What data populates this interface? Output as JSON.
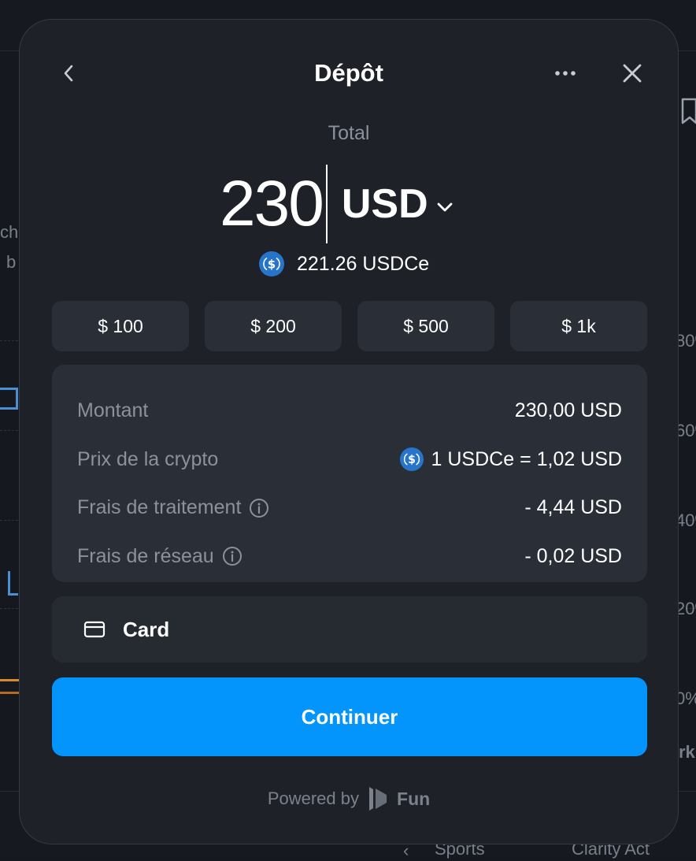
{
  "background": {
    "fragments": [
      "ch",
      "b",
      "80%",
      "60%",
      "40%",
      "20%",
      "0%",
      "rk",
      "Sports",
      "Clarity Act"
    ]
  },
  "modal": {
    "title": "Dépôt",
    "total_label": "Total",
    "amount_value": "230",
    "currency_code": "USD",
    "conversion_text": "221.26 USDCe",
    "presets": [
      "$ 100",
      "$ 200",
      "$ 500",
      "$ 1k"
    ],
    "summary": {
      "rows": [
        {
          "label": "Montant",
          "value": "230,00 USD"
        },
        {
          "label": "Prix de la crypto",
          "value": "1 USDCe = 1,02 USD"
        },
        {
          "label": "Frais de traitement",
          "value": "- 4,44 USD"
        },
        {
          "label": "Frais de réseau",
          "value": "- 0,02 USD"
        }
      ]
    },
    "payment_method": {
      "label": "Card"
    },
    "continue_label": "Continuer",
    "powered_by": "Powered by",
    "brand_name": "Fun"
  },
  "colors": {
    "modal_bg": "#1e2228",
    "panel_bg": "#2a2f37",
    "accent_blue": "#0394fc",
    "usdc_blue": "#2775ca",
    "muted_text": "#8b929c"
  },
  "icons": [
    "chevron-left-icon",
    "more-horizontal-icon",
    "close-icon",
    "chevron-down-icon",
    "usdc-coin-icon",
    "info-icon",
    "credit-card-icon",
    "fun-logo-icon",
    "bookmark-icon"
  ]
}
